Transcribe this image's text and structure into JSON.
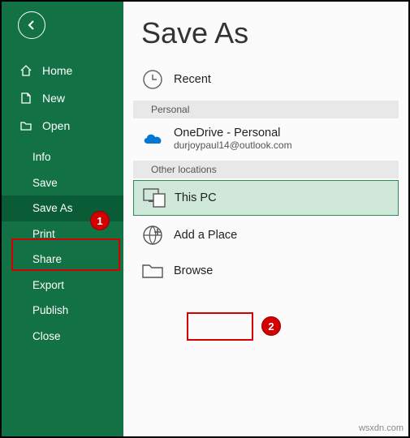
{
  "sidebar": {
    "nav": [
      {
        "label": "Home"
      },
      {
        "label": "New"
      },
      {
        "label": "Open"
      }
    ],
    "sub": [
      {
        "label": "Info"
      },
      {
        "label": "Save"
      },
      {
        "label": "Save As"
      },
      {
        "label": "Print"
      },
      {
        "label": "Share"
      },
      {
        "label": "Export"
      },
      {
        "label": "Publish"
      },
      {
        "label": "Close"
      }
    ]
  },
  "main": {
    "title": "Save As",
    "recent": "Recent",
    "sections": {
      "personal": "Personal",
      "other": "Other locations"
    },
    "onedrive": {
      "title": "OneDrive - Personal",
      "email": "durjoypaul14@outlook.com"
    },
    "thispc": "This PC",
    "addplace": "Add a Place",
    "browse": "Browse"
  },
  "callouts": {
    "one": "1",
    "two": "2"
  },
  "watermark": "wsxdn.com"
}
